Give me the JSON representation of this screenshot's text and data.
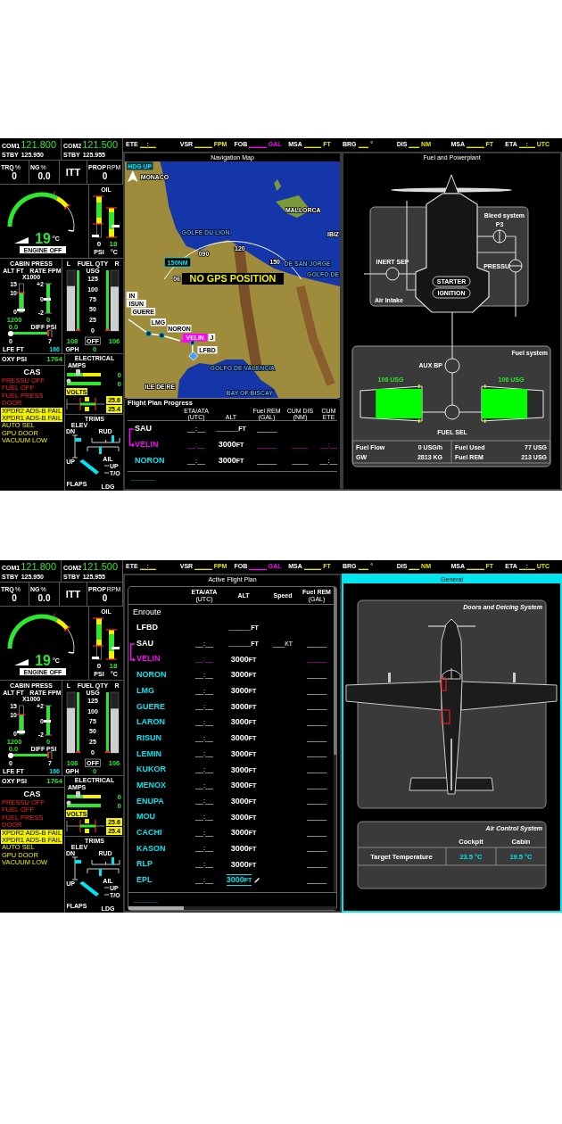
{
  "screens": [
    {
      "engine": {
        "com": [
          {
            "label": "COM1",
            "active": "121.800",
            "standby_label": "STBY",
            "standby": "125.950"
          },
          {
            "label": "COM2",
            "active": "121.500",
            "standby_label": "STBY",
            "standby": "125.955"
          }
        ],
        "readouts": [
          {
            "label": "TRQ",
            "unit": "%",
            "value": "0"
          },
          {
            "label": "NG",
            "unit": "%",
            "value": "0.0"
          }
        ],
        "itt": {
          "label": "ITT",
          "value": "19",
          "unit": "°C",
          "status": "ENGINE OFF"
        },
        "prop": {
          "label": "PROP",
          "unit": "RPM",
          "value": "0"
        },
        "oil": {
          "title": "OIL",
          "pressure": "0",
          "pressure_unit": "PSI",
          "temperature": "18",
          "temperature_unit": "°C"
        },
        "cabin_press": {
          "title": "CABIN PRESS",
          "alt_label": "ALT FT",
          "rate_label": "RATE FPM",
          "scale": "X1000",
          "alt_ticks": [
            "15",
            "10",
            "0"
          ],
          "rate_ticks": [
            "+2",
            "0",
            "-2"
          ],
          "alt_value": "1200",
          "rate_value": "0",
          "diff_value": "0.0",
          "diff_label": "DIFF PSI",
          "diff_ticks": [
            "0",
            "7"
          ],
          "lfe_label": "LFE FT",
          "lfe_value": "166"
        },
        "fuel_qty": {
          "title": "FUEL QTY",
          "unit": "USG",
          "ticks": [
            "125",
            "100",
            "75",
            "50",
            "25",
            "0"
          ],
          "tanks": [
            {
              "label": "L",
              "value": "108",
              "level": 0.74
            },
            {
              "label": "R",
              "value": "106",
              "level": 0.73
            }
          ],
          "pump": "OFF",
          "flow_label": "GPH",
          "flow_value": "0"
        },
        "oxy": {
          "label": "OXY PSI",
          "value": "1764"
        },
        "cas": {
          "title": "CAS",
          "messages": [
            {
              "text": "PRESSU OFF",
              "kind": "warning"
            },
            {
              "text": "FUEL OFF",
              "kind": "warning"
            },
            {
              "text": "FUEL PRESS",
              "kind": "warning"
            },
            {
              "text": "DOOR",
              "kind": "warning"
            },
            {
              "text": "XPDR2 ADS-B FAIL",
              "kind": "caution_new"
            },
            {
              "text": "XPDR1 ADS-B FAIL",
              "kind": "caution_new"
            },
            {
              "text": "AUTO SEL",
              "kind": "caution"
            },
            {
              "text": "GPU DOOR",
              "kind": "caution"
            },
            {
              "text": "VACUUM LOW",
              "kind": "caution"
            }
          ]
        },
        "electrical": {
          "title": "ELECTRICAL",
          "amps_label": "AMPS",
          "amps": [
            "0",
            "0"
          ],
          "volts_label": "VOLTS",
          "volts": [
            "25.6",
            "25.4"
          ]
        },
        "trims": {
          "title": "TRIMS",
          "elev": "ELEV",
          "down": "DN",
          "up": "UP",
          "rudder": "RUD",
          "aileron": "AIL",
          "flaps": "FLAPS",
          "flap_up": "UP",
          "flap_takeoff": "T/O",
          "flap_landing": "LDG"
        }
      },
      "top_bar": [
        {
          "label": "ETE",
          "value": "__:__",
          "color": "#e6e600"
        },
        {
          "label": "VSR",
          "value": "_____",
          "unit": "FPM",
          "color": "#e6e600"
        },
        {
          "label": "FOB",
          "value": "_____",
          "unit": "GAL",
          "color": "#ff00ff"
        },
        {
          "label": "MSA",
          "value": "_____",
          "unit": "FT",
          "color": "#e6e600"
        },
        {
          "label": "BRG",
          "value": "___",
          "unit": "°",
          "color": "#e6e600"
        },
        {
          "label": "DIS",
          "value": "___",
          "unit": "NM",
          "color": "#e6e600"
        },
        {
          "label": "MSA",
          "value": "_____",
          "unit": "FT",
          "color": "#e6e600"
        },
        {
          "label": "ETA",
          "value": "__:__",
          "unit": "UTC",
          "color": "#e6e600"
        }
      ],
      "center_pane": {
        "kind": "map",
        "title": "Navigation Map",
        "selected": false,
        "map": {
          "orientation": "HDG UP",
          "range": "150",
          "range_unit": "NM",
          "alert": "NO GPS POSITION",
          "headings": [
            "06",
            "090",
            "120",
            "150"
          ],
          "places": [
            {
              "name": "MONACO",
              "kind": "land"
            },
            {
              "name": "MALLORCA",
              "kind": "land"
            },
            {
              "name": "GOLFE DU LION",
              "kind": "water"
            },
            {
              "name": "IBIZ",
              "kind": "land"
            },
            {
              "name": "DE SAN JORGE",
              "kind": "water"
            },
            {
              "name": "GOLFO DE",
              "kind": "water"
            },
            {
              "name": "GOLFO DE VALENCIA",
              "kind": "water"
            },
            {
              "name": "BAY OF BISCAY",
              "kind": "water"
            },
            {
              "name": "ILE DE RE",
              "kind": "land"
            }
          ],
          "waypoints": [
            {
              "name": "IN",
              "active": false
            },
            {
              "name": "ISUN",
              "active": false
            },
            {
              "name": "GUERE",
              "active": false
            },
            {
              "name": "LMG",
              "active": false
            },
            {
              "name": "NORON",
              "active": false
            },
            {
              "name": "VELIN",
              "active": true
            },
            {
              "name": "J",
              "active": false
            },
            {
              "name": "LFBD",
              "active": false
            }
          ]
        },
        "progress": {
          "title": "Flight Plan Progress",
          "columns": [
            {
              "label": "ETA/ATA",
              "sub": "(UTC)"
            },
            {
              "label": "ALT"
            },
            {
              "label": "Fuel REM",
              "sub": "(GAL)"
            },
            {
              "label": "CUM DIS",
              "sub": "(NM)"
            },
            {
              "label": "CUM",
              "sub": "ETE"
            }
          ],
          "rows": [
            {
              "name": "SAU",
              "kind": "from",
              "eta": "__:__",
              "alt": "_____",
              "alt_unit": "FT",
              "fuel": "_____"
            },
            {
              "name": "VELIN",
              "kind": "active",
              "eta": "__:__",
              "alt": "3000",
              "alt_unit": "FT",
              "fuel": "_____",
              "dist": "____",
              "ete": "__:__"
            },
            {
              "name": "NORON",
              "kind": "future",
              "eta": "__:__",
              "alt": "3000",
              "alt_unit": "FT",
              "fuel": "_____",
              "dist": "____",
              "ete": "__:__"
            }
          ],
          "footer": "______"
        }
      },
      "right_pane": {
        "kind": "fuel_powerplant",
        "title": "Fuel and Powerplant",
        "selected": false,
        "bleed_title": "Bleed system",
        "intake_title": "Air Intake",
        "fuel_title": "Fuel system",
        "valves": [
          "P3",
          "PRESSU",
          "INERT SEP",
          "AUX BP",
          "FUEL SEL"
        ],
        "switches": [
          "STARTER",
          "IGNITION"
        ],
        "tanks": [
          {
            "quantity": "108 USG",
            "level": 0.75
          },
          {
            "quantity": "106 USG",
            "level": 0.74
          }
        ],
        "stats": [
          {
            "label": "Fuel Flow",
            "value": "0 USG/h"
          },
          {
            "label": "GW",
            "value": "2813 KG"
          },
          {
            "label": "Fuel Used",
            "value": "77 USG"
          },
          {
            "label": "Fuel REM",
            "value": "213 USG"
          }
        ]
      }
    },
    {
      "engine": {
        "com": [
          {
            "label": "COM1",
            "active": "121.800",
            "standby_label": "STBY",
            "standby": "125.950"
          },
          {
            "label": "COM2",
            "active": "121.500",
            "standby_label": "STBY",
            "standby": "125.955"
          }
        ],
        "readouts": [
          {
            "label": "TRQ",
            "unit": "%",
            "value": "0"
          },
          {
            "label": "NG",
            "unit": "%",
            "value": "0.0"
          }
        ],
        "itt": {
          "label": "ITT",
          "value": "19",
          "unit": "°C",
          "status": "ENGINE OFF"
        },
        "prop": {
          "label": "PROP",
          "unit": "RPM",
          "value": "0"
        },
        "oil": {
          "title": "OIL",
          "pressure": "0",
          "pressure_unit": "PSI",
          "temperature": "18",
          "temperature_unit": "°C"
        },
        "cabin_press": {
          "title": "CABIN PRESS",
          "alt_label": "ALT FT",
          "rate_label": "RATE FPM",
          "scale": "X1000",
          "alt_ticks": [
            "15",
            "10",
            "0"
          ],
          "rate_ticks": [
            "+2",
            "0",
            "-2"
          ],
          "alt_value": "1200",
          "rate_value": "0",
          "diff_value": "0.0",
          "diff_label": "DIFF PSI",
          "diff_ticks": [
            "0",
            "7"
          ],
          "lfe_label": "LFE FT",
          "lfe_value": "166"
        },
        "fuel_qty": {
          "title": "FUEL QTY",
          "unit": "USG",
          "ticks": [
            "125",
            "100",
            "75",
            "50",
            "25",
            "0"
          ],
          "tanks": [
            {
              "label": "L",
              "value": "108",
              "level": 0.74
            },
            {
              "label": "R",
              "value": "106",
              "level": 0.73
            }
          ],
          "pump": "OFF",
          "flow_label": "GPH",
          "flow_value": "0"
        },
        "oxy": {
          "label": "OXY PSI",
          "value": "1764"
        },
        "cas": {
          "title": "CAS",
          "messages": [
            {
              "text": "PRESSU OFF",
              "kind": "warning"
            },
            {
              "text": "FUEL OFF",
              "kind": "warning"
            },
            {
              "text": "FUEL PRESS",
              "kind": "warning"
            },
            {
              "text": "DOOR",
              "kind": "warning"
            },
            {
              "text": "XPDR2 ADS-B FAIL",
              "kind": "caution_new"
            },
            {
              "text": "XPDR1 ADS-B FAIL",
              "kind": "caution_new"
            },
            {
              "text": "AUTO SEL",
              "kind": "caution"
            },
            {
              "text": "GPU DOOR",
              "kind": "caution"
            },
            {
              "text": "VACUUM LOW",
              "kind": "caution"
            }
          ]
        },
        "electrical": {
          "title": "ELECTRICAL",
          "amps_label": "AMPS",
          "amps": [
            "0",
            "0"
          ],
          "volts_label": "VOLTS",
          "volts": [
            "25.6",
            "25.4"
          ]
        },
        "trims": {
          "title": "TRIMS",
          "elev": "ELEV",
          "down": "DN",
          "up": "UP",
          "rudder": "RUD",
          "aileron": "AIL",
          "flaps": "FLAPS",
          "flap_up": "UP",
          "flap_takeoff": "T/O",
          "flap_landing": "LDG"
        }
      },
      "top_bar": [
        {
          "label": "ETE",
          "value": "__:__",
          "color": "#e6e600"
        },
        {
          "label": "VSR",
          "value": "_____",
          "unit": "FPM",
          "color": "#e6e600"
        },
        {
          "label": "FOB",
          "value": "_____",
          "unit": "GAL",
          "color": "#ff00ff"
        },
        {
          "label": "MSA",
          "value": "_____",
          "unit": "FT",
          "color": "#e6e600"
        },
        {
          "label": "BRG",
          "value": "___",
          "unit": "°",
          "color": "#e6e600"
        },
        {
          "label": "DIS",
          "value": "___",
          "unit": "NM",
          "color": "#e6e600"
        },
        {
          "label": "MSA",
          "value": "_____",
          "unit": "FT",
          "color": "#e6e600"
        },
        {
          "label": "ETA",
          "value": "__:__",
          "unit": "UTC",
          "color": "#e6e600"
        }
      ],
      "center_pane": {
        "kind": "flight_plan",
        "title": "Active Flight Plan",
        "selected": false,
        "columns": [
          {
            "label": "ETA/ATA",
            "sub": "(UTC)"
          },
          {
            "label": "ALT"
          },
          {
            "label": "Speed"
          },
          {
            "label": "Fuel REM",
            "sub": "(GAL)"
          }
        ],
        "section": "Enroute",
        "rows": [
          {
            "name": "LFBD",
            "kind": "origin",
            "alt": "_____",
            "alt_unit": "FT",
            "editing": false
          },
          {
            "name": "SAU",
            "kind": "from",
            "eta": "__:__",
            "alt": "_____",
            "alt_unit": "FT",
            "speed": "___",
            "speed_unit": "KT",
            "fuel": "_____",
            "editing": false
          },
          {
            "name": "VELIN",
            "kind": "active",
            "eta": "__:__",
            "alt": "3000",
            "alt_unit": "FT",
            "fuel": "_____",
            "editing": false
          },
          {
            "name": "NORON",
            "kind": "future",
            "eta": "__:__",
            "alt": "3000",
            "alt_unit": "FT",
            "fuel": "_____",
            "editing": false
          },
          {
            "name": "LMG",
            "kind": "future",
            "eta": "__:__",
            "alt": "3000",
            "alt_unit": "FT",
            "fuel": "_____",
            "editing": false
          },
          {
            "name": "GUERE",
            "kind": "future",
            "eta": "__:__",
            "alt": "3000",
            "alt_unit": "FT",
            "fuel": "_____",
            "editing": false
          },
          {
            "name": "LARON",
            "kind": "future",
            "eta": "__:__",
            "alt": "3000",
            "alt_unit": "FT",
            "fuel": "_____",
            "editing": false
          },
          {
            "name": "RISUN",
            "kind": "future",
            "eta": "__:__",
            "alt": "3000",
            "alt_unit": "FT",
            "fuel": "_____",
            "editing": false
          },
          {
            "name": "LEMIN",
            "kind": "future",
            "eta": "__:__",
            "alt": "3000",
            "alt_unit": "FT",
            "fuel": "_____",
            "editing": false
          },
          {
            "name": "KUKOR",
            "kind": "future",
            "eta": "__:__",
            "alt": "3000",
            "alt_unit": "FT",
            "fuel": "_____",
            "editing": false
          },
          {
            "name": "MENOX",
            "kind": "future",
            "eta": "__:__",
            "alt": "3000",
            "alt_unit": "FT",
            "fuel": "_____",
            "editing": false
          },
          {
            "name": "ENUPA",
            "kind": "future",
            "eta": "__:__",
            "alt": "3000",
            "alt_unit": "FT",
            "fuel": "_____",
            "editing": false
          },
          {
            "name": "MOU",
            "kind": "future",
            "eta": "__:__",
            "alt": "3000",
            "alt_unit": "FT",
            "fuel": "_____",
            "editing": false
          },
          {
            "name": "CACHI",
            "kind": "future",
            "eta": "__:__",
            "alt": "3000",
            "alt_unit": "FT",
            "fuel": "_____",
            "editing": false
          },
          {
            "name": "KASON",
            "kind": "future",
            "eta": "__:__",
            "alt": "3000",
            "alt_unit": "FT",
            "fuel": "_____",
            "editing": false
          },
          {
            "name": "RLP",
            "kind": "future",
            "eta": "__:__",
            "alt": "3000",
            "alt_unit": "FT",
            "fuel": "_____",
            "editing": false
          },
          {
            "name": "EPL",
            "kind": "future",
            "eta": "__:__",
            "alt": "3000",
            "alt_unit": "FT",
            "fuel": "_____",
            "editing": true
          }
        ],
        "footer": "______"
      },
      "right_pane": {
        "kind": "general",
        "title": "General",
        "selected": true,
        "doors_title": "Doors and Deicing System",
        "doors": [
          {
            "open": true
          },
          {
            "open": true
          }
        ],
        "air_title": "Air Control System",
        "air_columns": [
          "Cockpit",
          "Cabin"
        ],
        "air_rows": [
          {
            "label": "Target Temperature",
            "values": [
              "23.5 °C",
              "19.5 °C"
            ]
          }
        ]
      }
    }
  ]
}
